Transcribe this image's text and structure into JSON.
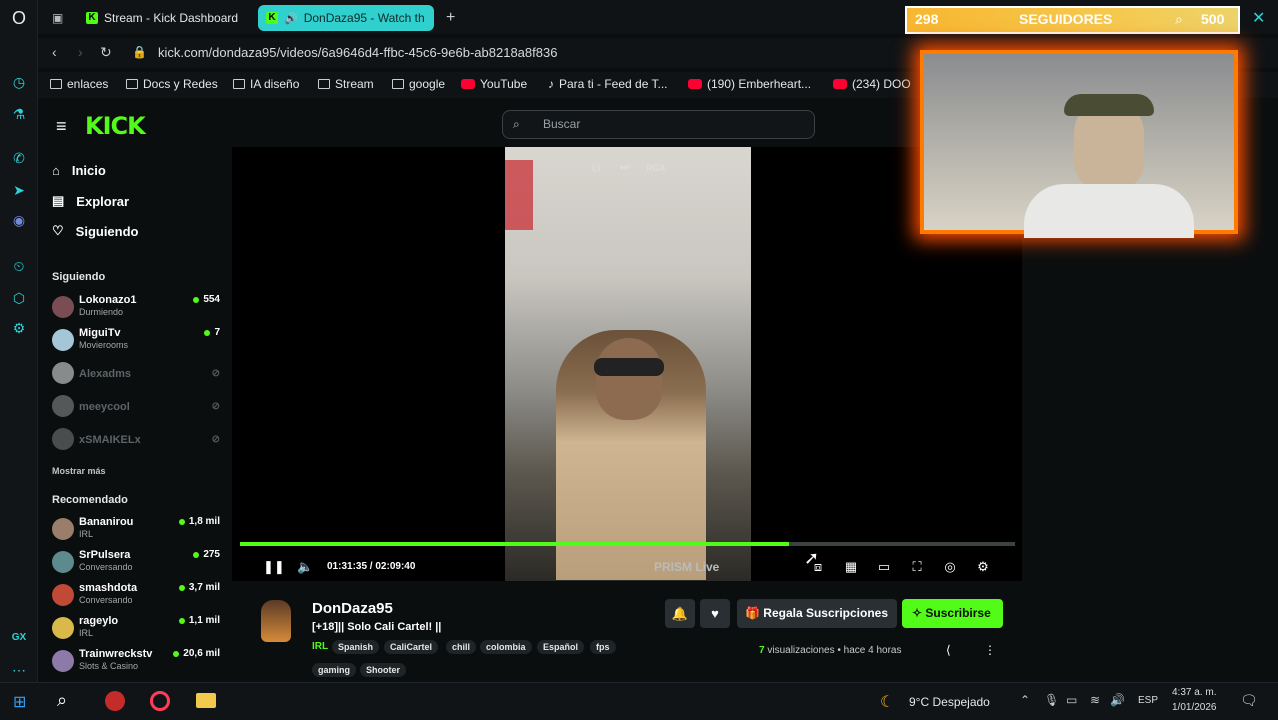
{
  "browser": {
    "tabs": [
      {
        "label": "Stream - Kick Dashboard"
      },
      {
        "label": "DonDaza95 - Watch th"
      }
    ],
    "url": "kick.com/dondaza95/videos/6a9646d4-ffbc-45c6-9e6b-ab8218a8f836",
    "bookmarks": [
      "enlaces",
      "Docs y Redes",
      "IA diseño",
      "Stream",
      "google",
      "YouTube",
      "Para ti - Feed de T...",
      "(190) Emberheart...",
      "(234) DOO"
    ]
  },
  "kick": {
    "search_placeholder": "Buscar",
    "nav": [
      "Inicio",
      "Explorar",
      "Siguiendo"
    ],
    "following_title": "Siguiendo",
    "following": [
      {
        "name": "Lokonazo1",
        "status": "Durmiendo",
        "viewers": "554",
        "live": true
      },
      {
        "name": "MiguiTv",
        "status": "Movierooms",
        "viewers": "7",
        "live": true
      },
      {
        "name": "Alexadms",
        "status": "",
        "viewers": "",
        "live": false
      },
      {
        "name": "meeycool",
        "status": "",
        "viewers": "",
        "live": false
      },
      {
        "name": "xSMAIKELx",
        "status": "",
        "viewers": "",
        "live": false
      }
    ],
    "show_more": "Mostrar más",
    "recommended_title": "Recomendado",
    "recommended": [
      {
        "name": "Bananirou",
        "status": "IRL",
        "viewers": "1,8 mil"
      },
      {
        "name": "SrPulsera",
        "status": "Conversando",
        "viewers": "275"
      },
      {
        "name": "smashdota",
        "status": "Conversando",
        "viewers": "3,7 mil"
      },
      {
        "name": "rageylo",
        "status": "IRL",
        "viewers": "1,1 mil"
      },
      {
        "name": "Trainwreckstv",
        "status": "Slots & Casino",
        "viewers": "20,6 mil"
      }
    ]
  },
  "player": {
    "time": "01:31:35 / 02:09:40",
    "progress": 0.708,
    "watermark": "PRISM Live",
    "overlay_label": "RGX"
  },
  "stream": {
    "channel": "DonDaza95",
    "title": "[+18]|| Solo Cali Cartel! ||",
    "category": "IRL",
    "tags": [
      "Spanish",
      "CaliCartel",
      "chill",
      "colombia",
      "Español",
      "fps",
      "gaming",
      "Shooter"
    ],
    "gift_label": "Regala Suscripciones",
    "subscribe_label": "Suscribirse",
    "views_count": "7",
    "views_label": "visualizaciones",
    "age": "hace 4 horas"
  },
  "overlay": {
    "followers_current": "298",
    "followers_label": "SEGUIDORES",
    "followers_goal": "500"
  },
  "taskbar": {
    "weather": "9°C Despejado",
    "lang": "ESP",
    "time": "4:37 a. m.",
    "date": "1/01/2026"
  },
  "colors": {
    "accent": "#53fc18",
    "background": "#0b0e0f",
    "opera": "#2bd3d8"
  }
}
